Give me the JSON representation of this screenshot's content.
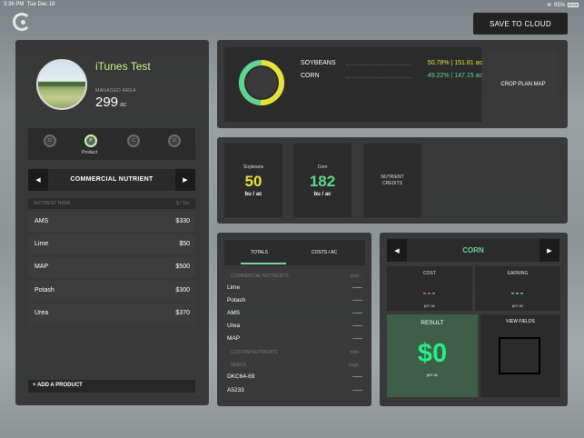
{
  "status_bar": {
    "time": "3:36 PM",
    "date": "Tue Dec 18",
    "battery": "95%"
  },
  "header": {
    "save_label": "SAVE TO CLOUD"
  },
  "field": {
    "name": "iTunes Test",
    "managed_label": "MANAGED AREA",
    "acres": "299",
    "acres_unit": "ac"
  },
  "steps": [
    {
      "letter": "D",
      "label": ""
    },
    {
      "letter": "P",
      "label": "Product"
    },
    {
      "letter": "C",
      "label": ""
    },
    {
      "letter": "D",
      "label": ""
    }
  ],
  "nutrient_panel": {
    "title": "COMMERCIAL NUTRIENT",
    "col_name": "NUTRIENT NAME",
    "col_price": "$ / Ton",
    "rows": [
      {
        "name": "AMS",
        "price": "$330"
      },
      {
        "name": "Lime",
        "price": "$50"
      },
      {
        "name": "MAP",
        "price": "$500"
      },
      {
        "name": "Potash",
        "price": "$300"
      },
      {
        "name": "Urea",
        "price": "$370"
      }
    ],
    "add_label": "+ ADD A PRODUCT"
  },
  "crop_split": {
    "crops": [
      {
        "name": "SOYBEANS",
        "value": "50.78% | 151.81 ac",
        "percent": 50.78,
        "color": "#e7e13c"
      },
      {
        "name": "CORN",
        "value": "49.22% | 147.15 ac",
        "percent": 49.22,
        "color": "#5fd68f"
      }
    ],
    "map_button": "CROP PLAN MAP"
  },
  "yield_cards": [
    {
      "title": "Soybeans",
      "value": "50",
      "unit": "bu / ac",
      "color": "#e7e13c"
    },
    {
      "title": "Corn",
      "value": "182",
      "unit": "bu / ac",
      "color": "#5fd68f"
    },
    {
      "title": "NUTRIENT CREDITS",
      "value": "",
      "unit": "",
      "color": "#ffffff"
    }
  ],
  "totals": {
    "tab_totals": "TOTALS",
    "tab_costs": "COSTS / AC",
    "commercial_header": "COMMERCIAL NUTRIENTS",
    "commercial_unit": "tons",
    "commercial_rows": [
      {
        "name": "Lime",
        "value": "-----"
      },
      {
        "name": "Potash",
        "value": "-----"
      },
      {
        "name": "AMS",
        "value": "-----"
      },
      {
        "name": "Urea",
        "value": "-----"
      },
      {
        "name": "MAP",
        "value": "-----"
      }
    ],
    "custom_header": "CUSTOM NUTRIENTS",
    "custom_unit": "tons",
    "seeds_header": "SEEDS",
    "seeds_unit": "bags",
    "seed_rows": [
      {
        "name": "DKC64-69",
        "value": "-----"
      },
      {
        "name": "A5233",
        "value": "-----"
      }
    ]
  },
  "crop_detail": {
    "crop": "CORN",
    "cost_label": "COST",
    "cost_value": "---",
    "cost_color": "#ef6f6f",
    "earning_label": "EARNING",
    "earning_value": "---",
    "earning_color": "#5fd68f",
    "per_ac": "per ac",
    "result_label": "RESULT",
    "result_value": "$0",
    "result_per": "per ac",
    "view_fields": "VIEW FIELDS"
  }
}
